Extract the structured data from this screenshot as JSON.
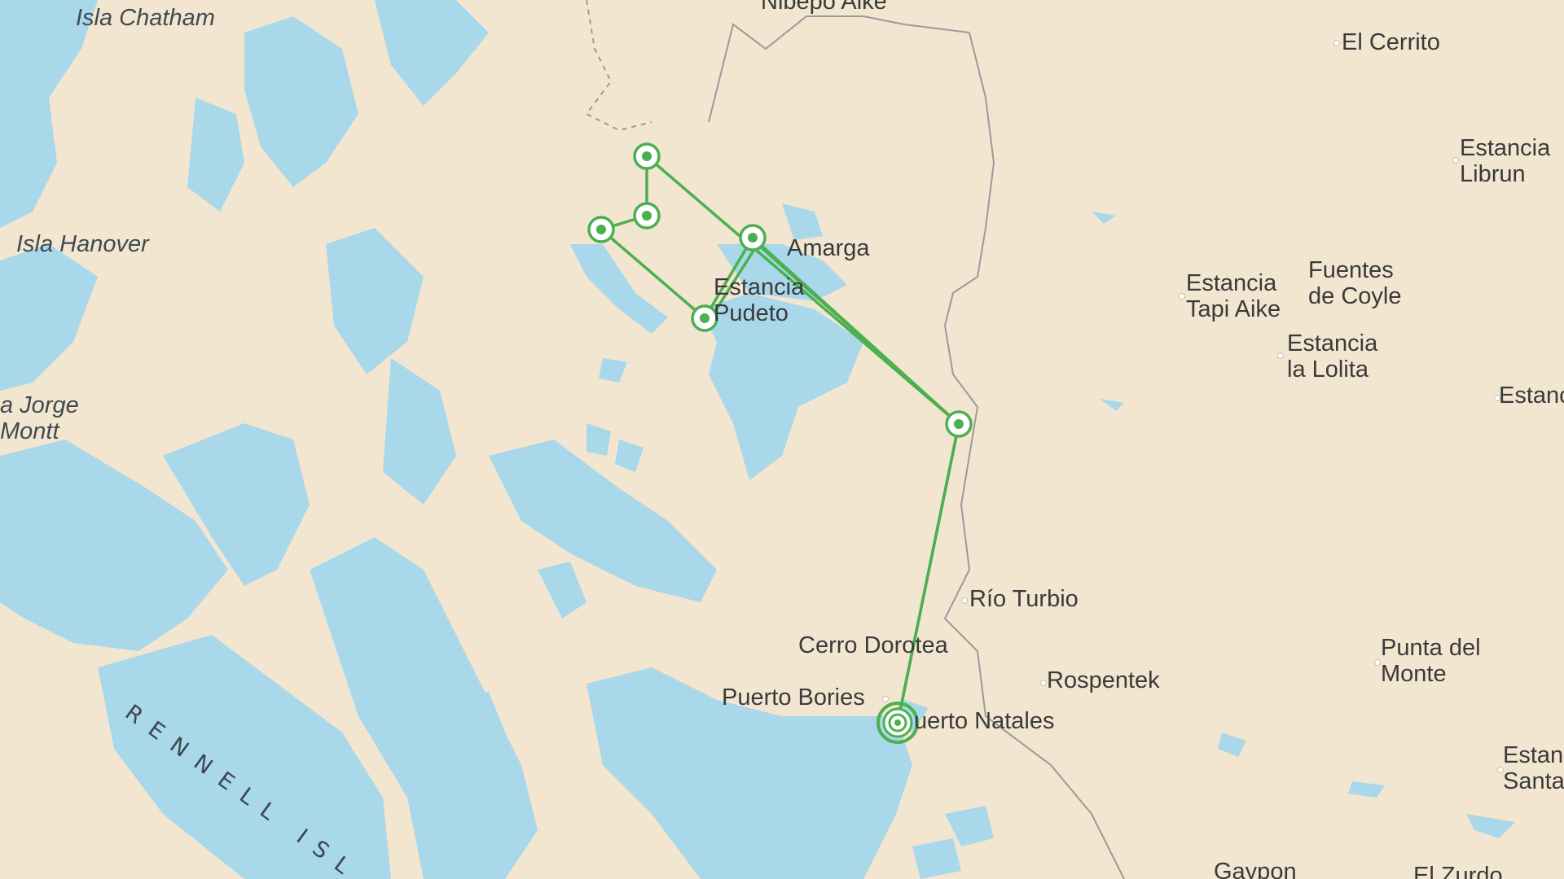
{
  "map": {
    "colors": {
      "land": "#f2e6d0",
      "water": "#a9d8ea",
      "route": "#4caf50",
      "border": "#9a9a9a",
      "label": "#3a3a3a"
    },
    "labels": {
      "nibepo_aike": "Nibepo Aike",
      "isla_chatham": "Isla Chatham",
      "el_cerrito": "El Cerrito",
      "estancia_librun": "Estancia Librun",
      "isla_hanover": "Isla Hanover",
      "amarga": "Amarga",
      "estancia_pudeto": "Estancia Pudeto",
      "estancia_tapi_aike": "Estancia Tapi Aike",
      "fuentes_de_coyle": "Fuentes de Coyle",
      "estancia_la_lolita": "Estancia la Lolita",
      "estan_partial": "Estanc",
      "jorge_montt": "a Jorge Montt",
      "rio_turbio": "Río Turbio",
      "cerro_dorotea": "Cerro Dorotea",
      "rospentek": "Rospentek",
      "punta_del_monte": "Punta del Monte",
      "puerto_bories": "Puerto Bories",
      "puerto_natales": "uerto Natales",
      "estancia_santa_partial": "Estan Santa",
      "rennell": "RENNELL ISL",
      "gaypon": "Gaypon",
      "el_zurdo": "El Zurdo"
    },
    "route": {
      "name": "trek-route",
      "stops": [
        {
          "id": "puerto-natales-start",
          "type": "start"
        },
        {
          "id": "border-waypoint"
        },
        {
          "id": "amarga-waypoint"
        },
        {
          "id": "north-waypoint"
        },
        {
          "id": "inner-waypoint"
        },
        {
          "id": "west-waypoint"
        },
        {
          "id": "pudeto-waypoint"
        }
      ]
    }
  }
}
